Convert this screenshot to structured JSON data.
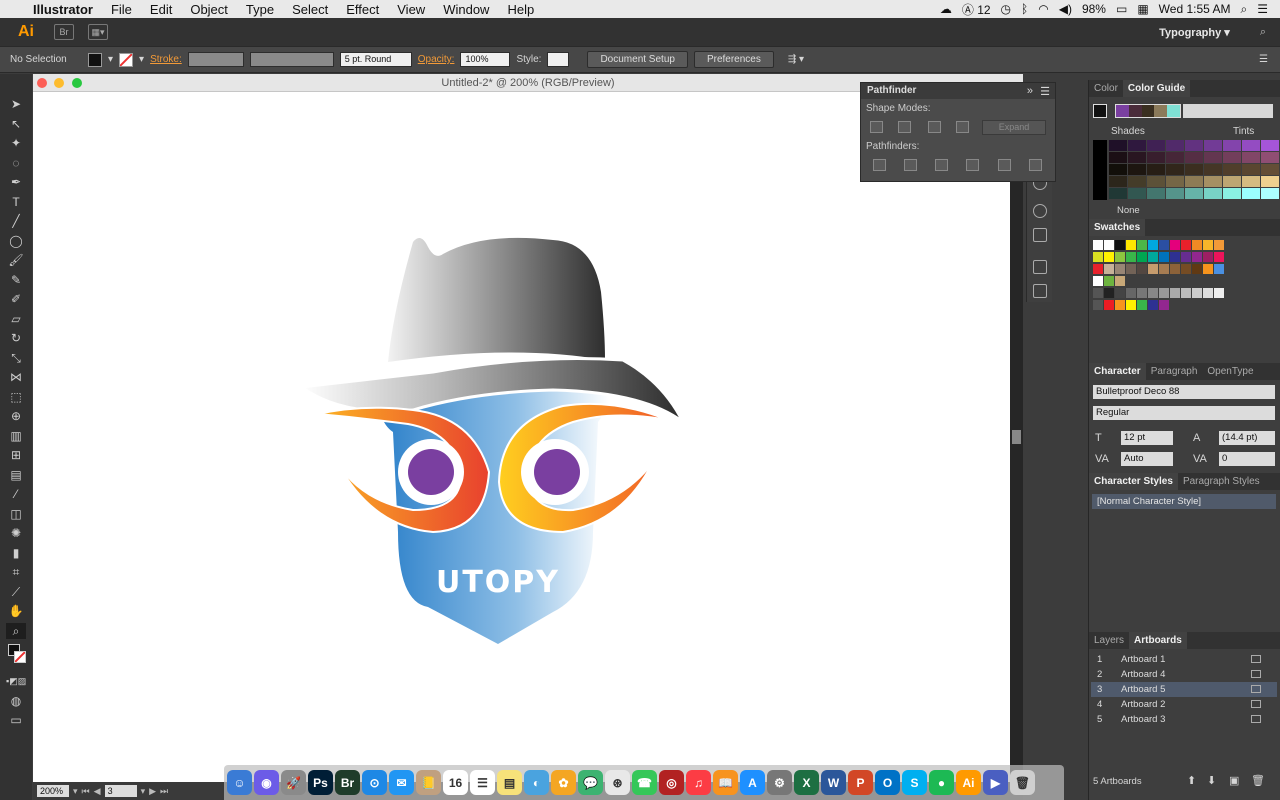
{
  "menubar": {
    "apple": "",
    "app": "Illustrator",
    "items": [
      "File",
      "Edit",
      "Object",
      "Type",
      "Select",
      "Effect",
      "View",
      "Window",
      "Help"
    ],
    "status_num": "12",
    "battery": "98%",
    "clock": "Wed 1:55 AM"
  },
  "appbar": {
    "logo": "Ai",
    "bridge": "Br",
    "workspace": "Typography"
  },
  "controlbar": {
    "selection": "No Selection",
    "stroke_label": "Stroke:",
    "profile": "5 pt. Round",
    "opacity_label": "Opacity:",
    "opacity_value": "100%",
    "style_label": "Style:",
    "doc_setup": "Document Setup",
    "preferences": "Preferences"
  },
  "document": {
    "title": "Untitled-2* @ 200% (RGB/Preview)"
  },
  "artwork": {
    "brand": "UTOPY"
  },
  "statusbar": {
    "zoom": "200%",
    "artboard": "3"
  },
  "pathfinder": {
    "title": "Pathfinder",
    "shape_modes": "Shape Modes:",
    "pathfinders": "Pathfinders:",
    "expand": "Expand"
  },
  "color_panel": {
    "tabs": [
      "Color",
      "Color Guide"
    ],
    "shades": "Shades",
    "tints": "Tints",
    "none": "None"
  },
  "swatches": {
    "title": "Swatches"
  },
  "character": {
    "tabs": [
      "Character",
      "Paragraph",
      "OpenType"
    ],
    "font": "Bulletproof Deco 88",
    "style": "Regular",
    "size": "12 pt",
    "leading": "(14.4 pt)",
    "kerning": "Auto",
    "tracking": "0"
  },
  "char_styles": {
    "tabs": [
      "Character Styles",
      "Paragraph Styles"
    ],
    "item": "[Normal Character Style]"
  },
  "artboards": {
    "tabs": [
      "Layers",
      "Artboards"
    ],
    "rows": [
      {
        "num": "1",
        "name": "Artboard 1"
      },
      {
        "num": "2",
        "name": "Artboard 4"
      },
      {
        "num": "3",
        "name": "Artboard 5"
      },
      {
        "num": "4",
        "name": "Artboard 2"
      },
      {
        "num": "5",
        "name": "Artboard 3"
      }
    ],
    "count": "5 Artboards"
  },
  "dock_apps": [
    "Finder",
    "Siri",
    "Launchpad",
    "Photoshop",
    "Bridge",
    "Safari",
    "Mail",
    "Contacts",
    "Calendar",
    "Reminders",
    "Notes",
    "Preview",
    "Photos",
    "Messages",
    "Chrome",
    "FaceTime",
    "Photo Booth",
    "iTunes",
    "iBooks",
    "App Store",
    "System Preferences",
    "Excel",
    "Word",
    "PowerPoint",
    "Outlook",
    "Skype",
    "Spotify",
    "Illustrator",
    "QuickTime",
    "Trash"
  ],
  "colors": {
    "accent_orange": "#ff9a00",
    "link_orange": "#f29a38",
    "eye_purple": "#7a3fa0",
    "face_blue": "#3a8fd0"
  }
}
